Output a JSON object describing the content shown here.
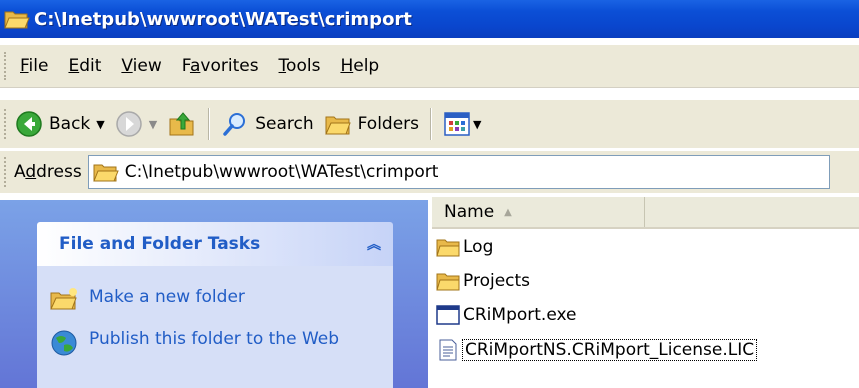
{
  "window": {
    "title": "C:\\Inetpub\\wwwroot\\WATest\\crimport"
  },
  "menu": {
    "file": {
      "accel": "F",
      "rest": "ile"
    },
    "edit": {
      "accel": "E",
      "rest": "dit"
    },
    "view": {
      "accel": "V",
      "rest": "iew"
    },
    "favorites": {
      "pre": "F",
      "accel": "a",
      "rest": "vorites"
    },
    "tools": {
      "accel": "T",
      "rest": "ools"
    },
    "help": {
      "accel": "H",
      "rest": "elp"
    }
  },
  "toolbar": {
    "back_label": "Back",
    "search_label": "Search",
    "folders_label": "Folders"
  },
  "address": {
    "label_pre": "A",
    "label_accel": "d",
    "label_rest": "dress",
    "value": "C:\\Inetpub\\wwwroot\\WATest\\crimport"
  },
  "tasks": {
    "header": "File and Folder Tasks",
    "items": [
      {
        "label": "Make a new folder",
        "icon": "new-folder-icon"
      },
      {
        "label": "Publish this folder to the Web",
        "icon": "publish-web-icon"
      }
    ]
  },
  "files": {
    "column_name": "Name",
    "sort_icon": "sort-ascending-icon",
    "rows": [
      {
        "name": "Log",
        "icon": "folder-icon"
      },
      {
        "name": "Projects",
        "icon": "folder-icon"
      },
      {
        "name": "CRiMport.exe",
        "icon": "exe-window-icon"
      },
      {
        "name": "CRiMportNS.CRiMport_License.LIC",
        "icon": "text-file-icon"
      }
    ]
  },
  "colors": {
    "titlebar": "#0a46cd",
    "chrome": "#ece9d8",
    "task_link": "#215dc6",
    "task_pane": "#6b8fdf"
  }
}
